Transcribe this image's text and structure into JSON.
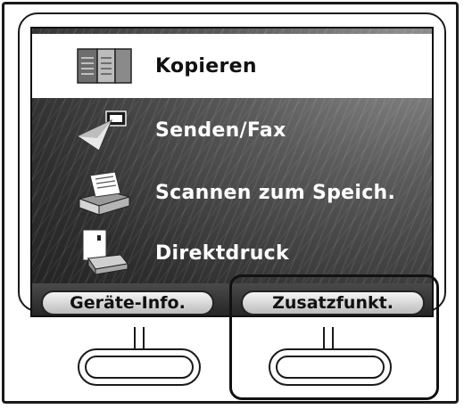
{
  "menu": {
    "items": [
      {
        "label": "Kopieren",
        "icon": "copy-icon",
        "selected": true
      },
      {
        "label": "Senden/Fax",
        "icon": "send-fax-icon",
        "selected": false
      },
      {
        "label": "Scannen zum Speich.",
        "icon": "scanner-icon",
        "selected": false
      },
      {
        "label": "Direktdruck",
        "icon": "usb-print-icon",
        "selected": false
      }
    ]
  },
  "softkeys": {
    "left_label": "Geräte-Info.",
    "right_label": "Zusatzfunkt."
  },
  "colors": {
    "screen_dark": "#2f2f2f",
    "selected_bg": "#ffffff",
    "highlight_border": "#111111"
  }
}
